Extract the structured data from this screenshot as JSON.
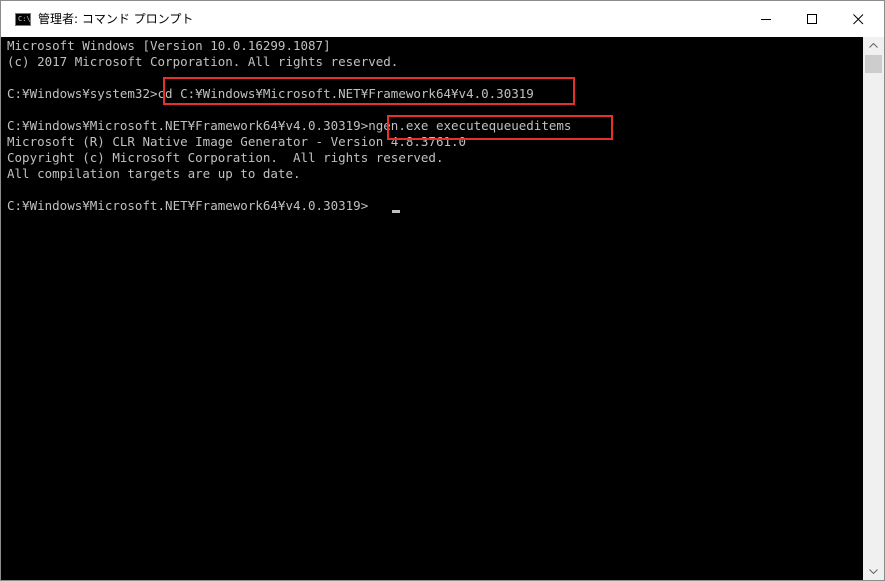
{
  "window": {
    "icon_label": "C:\\",
    "title": "管理者: コマンド プロンプト",
    "controls": {
      "minimize": "minimize",
      "maximize": "maximize",
      "close": "close"
    }
  },
  "console": {
    "lines": [
      "Microsoft Windows [Version 10.0.16299.1087]",
      "(c) 2017 Microsoft Corporation. All rights reserved.",
      "",
      "C:¥Windows¥system32>cd C:¥Windows¥Microsoft.NET¥Framework64¥v4.0.30319",
      "",
      "C:¥Windows¥Microsoft.NET¥Framework64¥v4.0.30319>ngen.exe executequeueditems",
      "Microsoft (R) CLR Native Image Generator - Version 4.8.3761.0",
      "Copyright (c) Microsoft Corporation.  All rights reserved.",
      "All compilation targets are up to date.",
      "",
      "C:¥Windows¥Microsoft.NET¥Framework64¥v4.0.30319>"
    ],
    "text_color": "#c0c0c0",
    "background": "#000000",
    "highlight_color": "#e5312c"
  },
  "scrollbar": {
    "up": "scroll-up-arrow",
    "down": "scroll-down-arrow"
  }
}
